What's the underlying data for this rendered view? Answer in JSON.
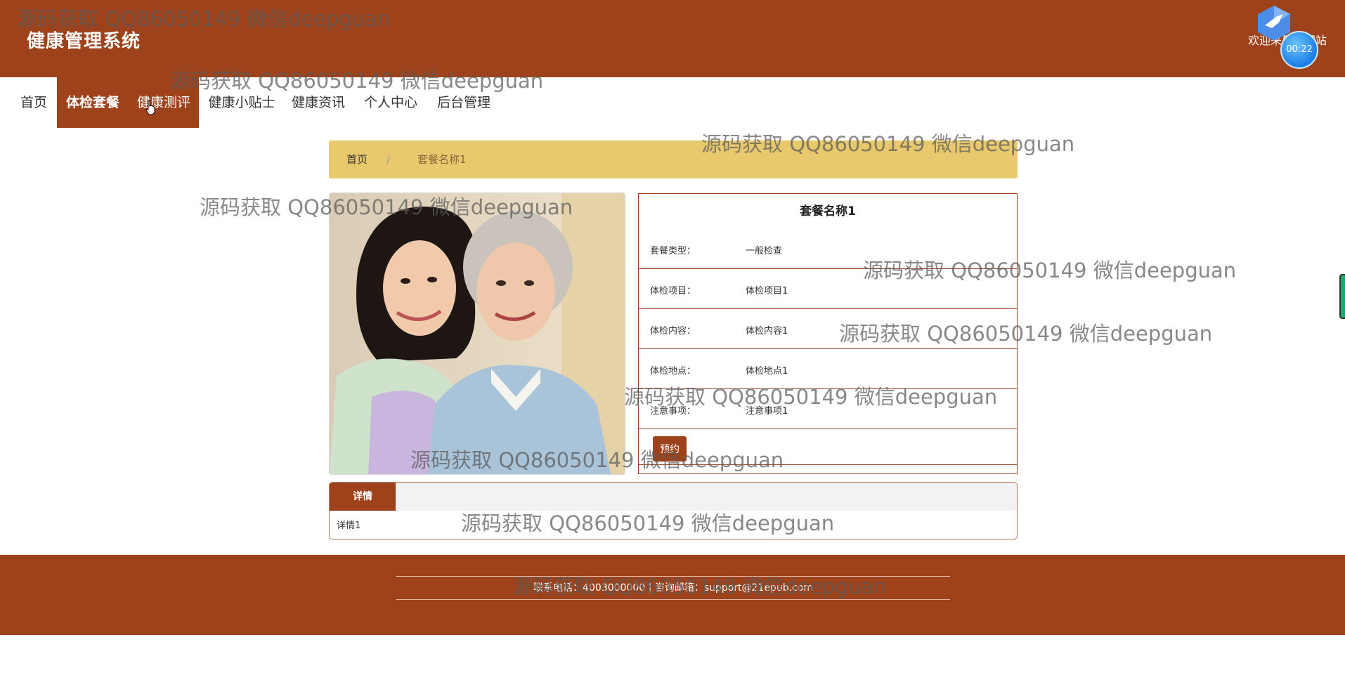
{
  "header": {
    "title": "健康管理系统",
    "welcome": "欢迎来到本网站",
    "timer": "00:22"
  },
  "nav": {
    "items": [
      {
        "label": "首页"
      },
      {
        "label": "体检套餐"
      },
      {
        "label": "健康测评"
      },
      {
        "label": "健康小贴士"
      },
      {
        "label": "健康资讯"
      },
      {
        "label": "个人中心"
      },
      {
        "label": "后台管理"
      }
    ]
  },
  "breadcrumb": {
    "home": "首页",
    "separator": "/",
    "current": "套餐名称1"
  },
  "detail": {
    "title": "套餐名称1",
    "rows": [
      {
        "label": "套餐类型：",
        "value": "一般检查"
      },
      {
        "label": "体检项目：",
        "value": "体检项目1"
      },
      {
        "label": "体检内容：",
        "value": "体检内容1"
      },
      {
        "label": "体检地点：",
        "value": "体检地点1"
      },
      {
        "label": "注意事项：",
        "value": "注意事项1"
      }
    ],
    "book_label": "预约"
  },
  "tabs": {
    "active_label": "详情",
    "content": "详情1"
  },
  "footer": {
    "text": "联系电话：4003000000 | 咨询邮箱：support@21epub.com"
  },
  "watermark": "源码获取 QQ86050149 微信deepguan",
  "colors": {
    "primary": "#9e421c",
    "breadcrumb_bg": "#e8c96e"
  }
}
